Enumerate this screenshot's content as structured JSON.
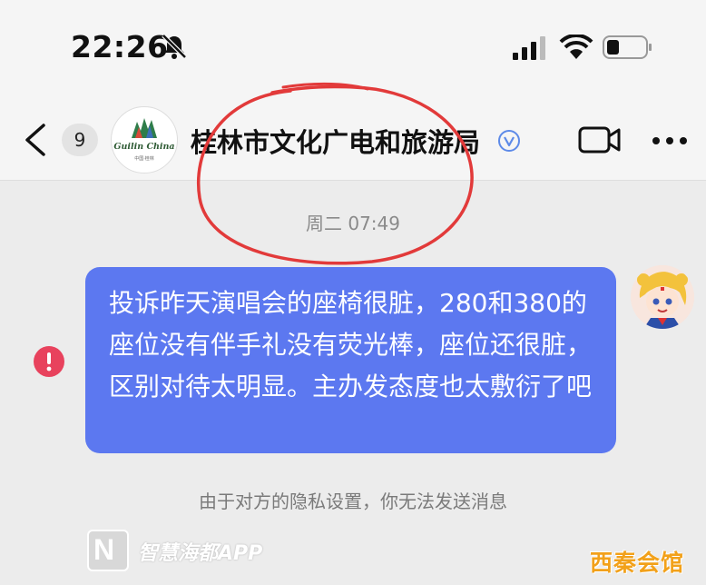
{
  "status_bar": {
    "time": "22:26",
    "icons": [
      "bell-muted-icon",
      "signal-icon",
      "wifi-icon",
      "battery-icon"
    ]
  },
  "header": {
    "back_icon": "chevron-left-icon",
    "unread_count": "9",
    "avatar_logo_text": "Guilin China",
    "avatar_logo_sub": "中国·桂林",
    "title": "桂林市文化广电和旅游局",
    "verified_icon": "verified-badge-icon",
    "video_icon": "video-camera-icon",
    "more_icon": "more-dots-icon"
  },
  "chat": {
    "timestamp": "周二 07:49",
    "message": {
      "text": "投诉昨天演唱会的座椅很脏，280和380的座位没有伴手礼没有荧光棒，座位还很脏，区别对待太明显。主办发态度也太敷衍了吧",
      "status_icon": "send-failed-icon"
    },
    "privacy_notice": "由于对方的隐私设置，你无法发送消息"
  },
  "watermarks": {
    "app_logo_letter": "N",
    "app_name": "智慧海都APP",
    "site": "西秦会馆"
  },
  "colors": {
    "bubble": "#5c78f0",
    "error": "#e8425d",
    "annotation_circle": "#e23a3a",
    "verified": "#5d8ae8"
  }
}
